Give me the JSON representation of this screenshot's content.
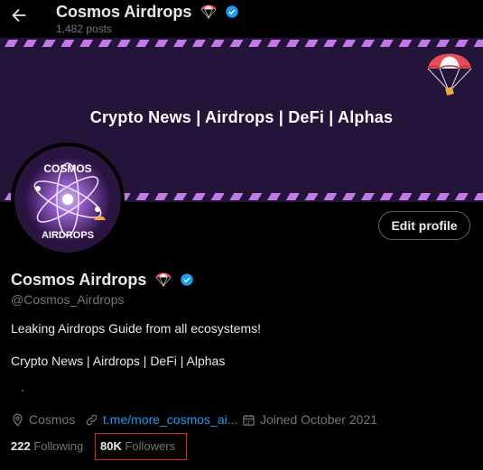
{
  "header": {
    "name": "Cosmos Airdrops",
    "posts_count": "1,482 posts"
  },
  "banner": {
    "text": "Crypto News | Airdrops | DeFi | Alphas"
  },
  "avatar": {
    "line1": "COSMOS",
    "line2": "AIRDROPS"
  },
  "profile": {
    "edit_label": "Edit profile",
    "name": "Cosmos Airdrops",
    "handle": "@Cosmos_Airdrops",
    "bio_line1": "Leaking Airdrops Guide from all ecosystems!",
    "bio_line2": "Crypto News | Airdrops | DeFi | Alphas",
    "location": "Cosmos",
    "link": "t.me/more_cosmos_ai...",
    "joined": "Joined October 2021",
    "following_count": "222",
    "following_label": "Following",
    "followers_count": "80K",
    "followers_label": "Followers"
  },
  "icons": {
    "back": "arrow-left-icon",
    "verified": "verified-badge-icon",
    "parachute": "parachute-emoji-icon",
    "location": "location-pin-icon",
    "link": "link-icon",
    "calendar": "calendar-icon"
  },
  "colors": {
    "background": "#000000",
    "banner": "#25143a",
    "stripe": "#c07ae6",
    "accent": "#1d9bf0",
    "muted": "#71767b",
    "highlight": "#dd2222"
  }
}
